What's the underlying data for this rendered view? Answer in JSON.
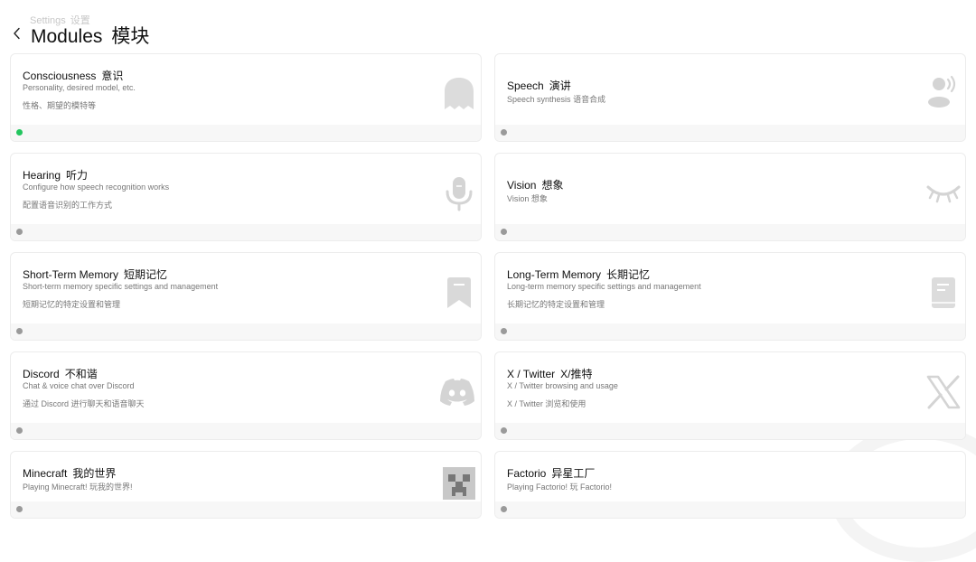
{
  "header": {
    "breadcrumb_en": "Settings",
    "breadcrumb_zh": "设置",
    "title_en": "Modules",
    "title_zh": "模块"
  },
  "colors": {
    "active_dot": "#22c55e",
    "inactive_dot": "#9a9a9a",
    "icon_gray": "#d4d4d4"
  },
  "modules": [
    {
      "title_en": "Consciousness",
      "title_zh": "意识",
      "desc_en": "Personality, desired model, etc.",
      "desc_zh": "性格、期望的模特等",
      "icon": "ghost-icon",
      "active": true
    },
    {
      "title_en": "Speech",
      "title_zh": "演讲",
      "desc_en": "Speech synthesis",
      "desc_zh": "语音合成",
      "icon": "speaking-person-icon",
      "active": false
    },
    {
      "title_en": "Hearing",
      "title_zh": "听力",
      "desc_en": "Configure how speech recognition works",
      "desc_zh": "配置语音识别的工作方式",
      "icon": "microphone-icon",
      "active": false
    },
    {
      "title_en": "Vision",
      "title_zh": "想象",
      "desc_en": "Vision",
      "desc_zh": "想象",
      "icon": "closed-eye-icon",
      "active": false
    },
    {
      "title_en": "Short-Term Memory",
      "title_zh": "短期记忆",
      "desc_en": "Short-term memory specific settings and management",
      "desc_zh": "短期记忆的特定设置和管理",
      "icon": "bookmark-icon",
      "active": false
    },
    {
      "title_en": "Long-Term Memory",
      "title_zh": "长期记忆",
      "desc_en": "Long-term memory specific settings and management",
      "desc_zh": "长期记忆的特定设置和管理",
      "icon": "notebook-icon",
      "active": false
    },
    {
      "title_en": "Discord",
      "title_zh": "不和谐",
      "desc_en": "Chat & voice chat over Discord",
      "desc_zh": "通过 Discord 进行聊天和语音聊天",
      "icon": "discord-icon",
      "active": false
    },
    {
      "title_en": "X / Twitter",
      "title_zh": "X/推特",
      "desc_en": "X / Twitter browsing and usage",
      "desc_zh": "X / Twitter 浏览和使用",
      "icon": "x-logo-icon",
      "active": false
    },
    {
      "title_en": "Minecraft",
      "title_zh": "我的世界",
      "desc_en": "Playing Minecraft!",
      "desc_zh": "玩我的世界!",
      "icon": "creeper-icon",
      "active": false
    },
    {
      "title_en": "Factorio",
      "title_zh": "异星工厂",
      "desc_en": "Playing Factorio!",
      "desc_zh": "玩 Factorio!",
      "icon": "",
      "active": false
    }
  ]
}
